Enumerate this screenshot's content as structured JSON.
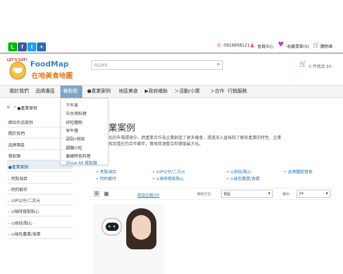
{
  "social": [
    {
      "icon": "line-icon",
      "glyph": "L",
      "color": "#00b900"
    },
    {
      "icon": "facebook-icon",
      "glyph": "f",
      "color": "#3b5998"
    },
    {
      "icon": "twitter-icon",
      "glyph": "t",
      "color": "#1da1f2"
    },
    {
      "icon": "share-plus-icon",
      "glyph": "+",
      "color": "#2a6ebb"
    }
  ],
  "topbar": {
    "phone": "0916858121",
    "member": "會員中心",
    "wishlist": "收藏清單(0)",
    "cart": "購物車"
  },
  "logo": {
    "badge": "LET'S EAT!",
    "brand": "FoodMap",
    "subtitle": "在地美食地圖"
  },
  "search": {
    "placeholder": "商品搜尋"
  },
  "header_cart": {
    "text": "0 件商品 $0"
  },
  "menu": [
    "關於我們",
    "品牌專區",
    "餐飲類",
    "●產業案例",
    "地區美食",
    "▶政府補助",
    "＞活動/小聚",
    "＞合作",
    "行銷服務"
  ],
  "dropdown": {
    "items": [
      "下午茶",
      "中台灣料理",
      "好吃糧物",
      "早午餐",
      "甜點•烘焙",
      "鍋類小吃",
      "泰國特色料理"
    ],
    "show_all": "Show All 餐飲類"
  },
  "breadcrumb": {
    "current": "●產業案例",
    "sep": ">"
  },
  "sidebar": [
    "網站作品案例",
    "關於我們",
    "品牌專區",
    "餐飲類",
    "●產業案例",
    "- 亮點項目",
    "- 特約夥伴",
    "- ⊙IP公仔/二次元",
    "- ⊙咖啡餐飲點心",
    "- ⊙烘焙/點心",
    "- ⊙綠色農業/漁業"
  ],
  "page": {
    "title": "業案例",
    "desc1": "化的市場環境中，跨產業合作為企業創造了更多機會，透過深入直採和了解各產業的特性，企業",
    "desc2": "找到潛在的合作夥伴，實現資源整合和價值最大化。"
  },
  "categories": [
    "亮點項目",
    "⊙IP公仔/二次元",
    "⊙烘焙/點心",
    "品牌體經營表",
    "特約夥伴",
    "⊙咖啡餐飲點心",
    "⊙綠色農業/漁業"
  ],
  "toolbar": {
    "compare": "商品比較(0)",
    "sort_label": "排序方式：",
    "sort_value": "預設",
    "show_label": "顯示：",
    "show_value": "24"
  }
}
